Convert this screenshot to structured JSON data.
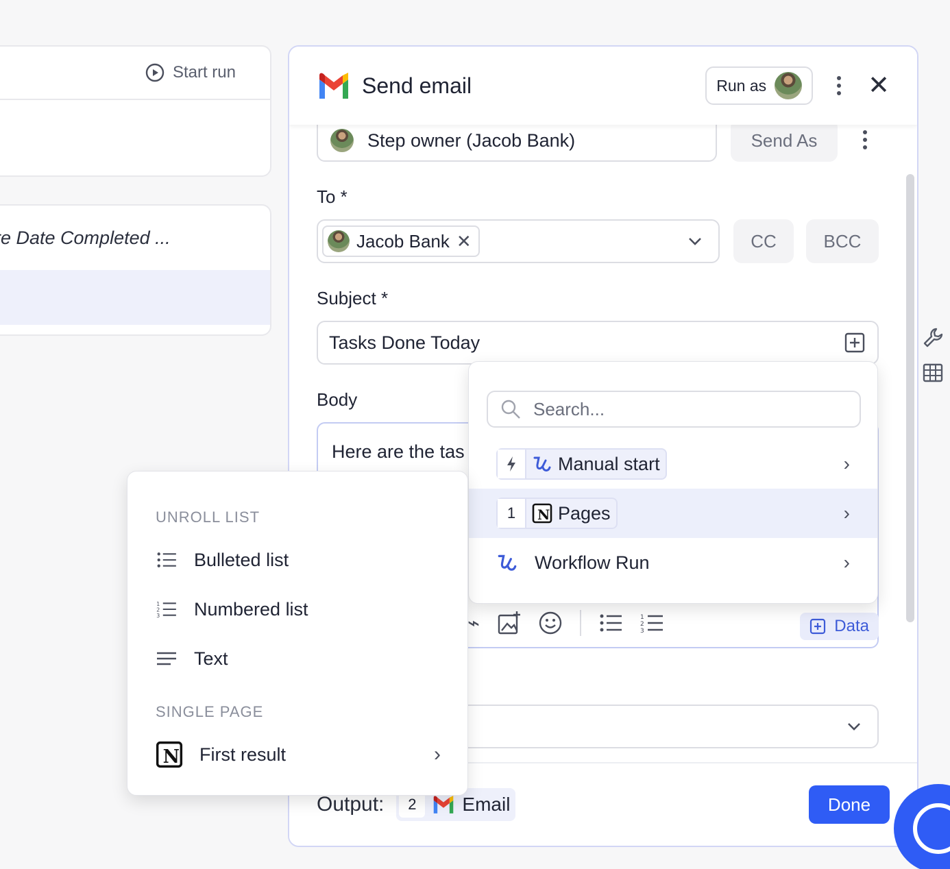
{
  "background": {
    "top_card": {
      "start_run_label": "Start run"
    },
    "mid_card": {
      "truncated_text": "re Date Completed ..."
    }
  },
  "panel": {
    "title": "Send email",
    "run_as_label": "Run as",
    "send_as": {
      "value": "Step owner (Jacob Bank)",
      "button_label": "Send As"
    },
    "to": {
      "label": "To *",
      "recipient": "Jacob Bank",
      "cc_label": "CC",
      "bcc_label": "BCC"
    },
    "subject": {
      "label": "Subject *",
      "value": "Tasks Done Today"
    },
    "body": {
      "label": "Body",
      "text": "Here are the tas"
    },
    "data_button_label": "Data",
    "footer": {
      "output_label": "Output:",
      "output_step_number": "2",
      "output_name": "Email",
      "done_label": "Done"
    }
  },
  "dropdown": {
    "search_placeholder": "Search...",
    "items": [
      {
        "label": "Manual start"
      },
      {
        "step_number": "1",
        "label": "Pages"
      },
      {
        "label": "Workflow Run"
      }
    ]
  },
  "popup": {
    "section_unroll": "UNROLL LIST",
    "items": [
      {
        "label": "Bulleted list"
      },
      {
        "label": "Numbered list"
      },
      {
        "label": "Text"
      }
    ],
    "section_single": "SINGLE PAGE",
    "first_result_label": "First result"
  },
  "colors": {
    "accent": "#2f5cf5",
    "highlight": "#eceffb",
    "panel_border": "#d2d6f5"
  }
}
